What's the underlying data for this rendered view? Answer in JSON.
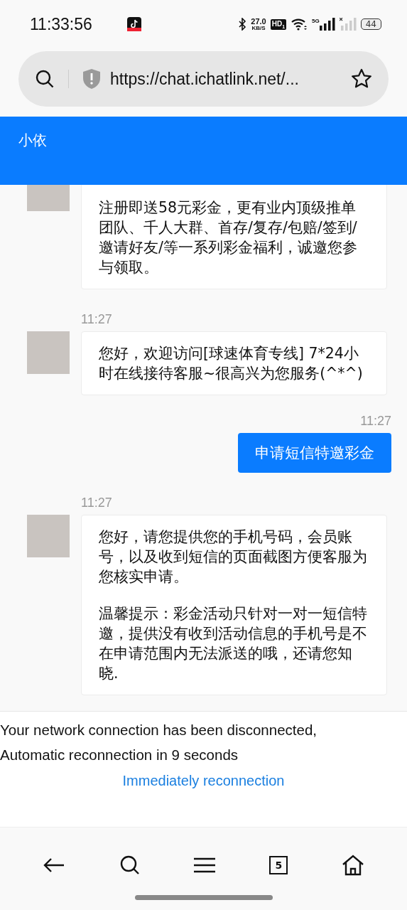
{
  "status_bar": {
    "time": "11:33:56",
    "speed_value": "27.0",
    "speed_unit": "KB/S",
    "hd_label": "HD",
    "hd_index": "1",
    "network_label": "5G",
    "battery": "44"
  },
  "address_bar": {
    "url": "https://chat.ichatlink.net/..."
  },
  "chat_header": {
    "title": "小依"
  },
  "messages": [
    {
      "kind": "agent",
      "paragraphs": [
        "注册即送58元彩金，更有业内顶级推单团队、千人大群、首存/复存/包赔/签到/邀请好友/等一系列彩金福利，诚邀您参与领取。"
      ]
    },
    {
      "kind": "agent",
      "time": "11:27",
      "paragraphs": [
        "您好，欢迎访问[球速体育专线] 7*24小时在线接待客服~很高兴为您服务(^*^)"
      ]
    },
    {
      "kind": "user",
      "time": "11:27",
      "paragraphs": [
        "申请短信特邀彩金"
      ]
    },
    {
      "kind": "agent",
      "time": "11:27",
      "paragraphs": [
        "您好，请您提供您的手机号码，会员账号，以及收到短信的页面截图方便客服为您核实申请。",
        "温馨提示：彩金活动只针对一对一短信特邀，提供没有收到活动信息的手机号是不在申请范围内无法派送的哦，还请您知晓."
      ]
    }
  ],
  "disconnect_banner": {
    "message_lines": [
      "Your network connection has been disconnected,",
      "Automatic reconnection in 9 seconds"
    ],
    "reconnect_link": "Immediately reconnection"
  },
  "bottom_nav": {
    "tab_count": "5"
  }
}
